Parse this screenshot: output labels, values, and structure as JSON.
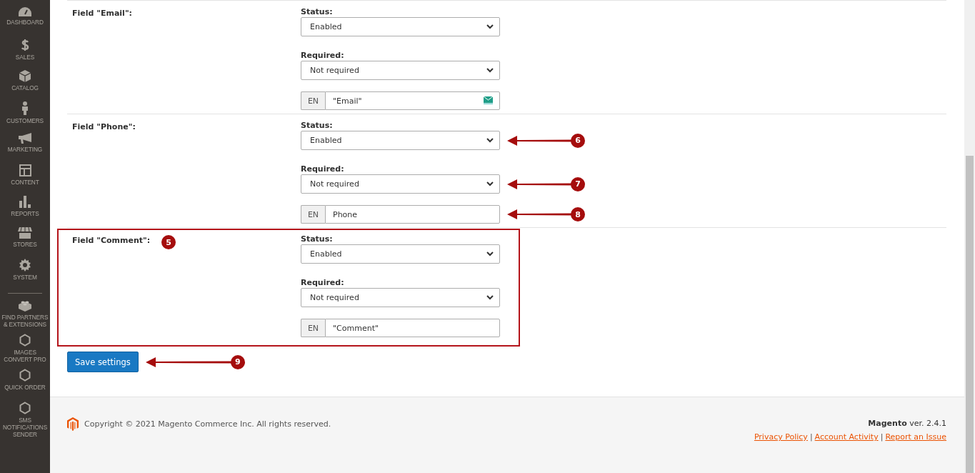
{
  "sidebar": {
    "groups": [
      [
        {
          "label": "DASHBOARD"
        },
        {
          "label": "SALES"
        },
        {
          "label": "CATALOG"
        },
        {
          "label": "CUSTOMERS"
        },
        {
          "label": "MARKETING"
        },
        {
          "label": "CONTENT"
        },
        {
          "label": "REPORTS"
        },
        {
          "label": "STORES"
        },
        {
          "label": "SYSTEM"
        }
      ],
      [
        {
          "label": "FIND PARTNERS & EXTENSIONS"
        },
        {
          "label": "IMAGES CONVERT PRO"
        },
        {
          "label": "QUICK ORDER"
        },
        {
          "label": "SMS NOTIFICATIONS SENDER"
        }
      ]
    ]
  },
  "fields": [
    {
      "label": "Field \"Email\":",
      "status_label": "Status:",
      "status": "Enabled",
      "required_label": "Required:",
      "required": "Not required",
      "language": "EN",
      "name": "\"Email\"",
      "name_icon": true,
      "highlighted": false
    },
    {
      "label": "Field \"Phone\":",
      "status_label": "Status:",
      "status": "Enabled",
      "required_label": "Required:",
      "required": "Not required",
      "language": "EN",
      "name": "Phone",
      "name_icon": false,
      "highlighted": false,
      "status_marker": "6",
      "required_marker": "7",
      "name_marker": "8"
    },
    {
      "label": "Field \"Comment\":",
      "status_label": "Status:",
      "status": "Enabled",
      "required_label": "Required:",
      "required": "Not required",
      "language": "EN",
      "name": "\"Comment\"",
      "name_icon": false,
      "highlighted": true,
      "label_marker": "5"
    }
  ],
  "save_button": {
    "label": "Save settings",
    "marker": "9"
  },
  "footer": {
    "copyright": "Copyright © 2021 Magento Commerce Inc. All rights reserved.",
    "version": "**Magento** ver. 2.4.1",
    "links": [
      {
        "kind": "link",
        "label": "Privacy Policy"
      },
      {
        "kind": "separator",
        "label": "|"
      },
      {
        "kind": "link",
        "label": "Account Activity"
      },
      {
        "kind": "separator",
        "label": "|"
      },
      {
        "kind": "link",
        "label": "Report an Issue"
      }
    ]
  }
}
